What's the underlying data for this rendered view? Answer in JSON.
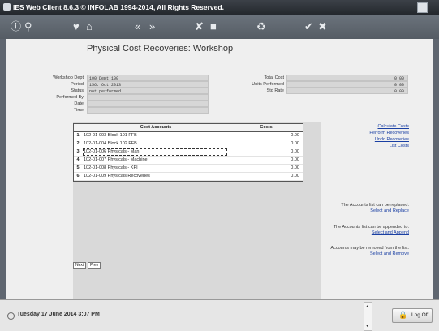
{
  "window": {
    "title": "IES Web Client 8.6.3 © INFOLAB 1994-2014, All Rights Reserved."
  },
  "page": {
    "heading": "Physical Cost Recoveries: Workshop"
  },
  "form": {
    "workshop_dept_label": "Workshop Dept",
    "workshop_dept_value": "100 Dept 100",
    "period_label": "Period",
    "period_value": "156: Oct 2013",
    "status_label": "Status",
    "status_value": "not performed",
    "performed_by_label": "Performed By",
    "performed_by_value": "",
    "date_label": "Date",
    "date_value": "",
    "time_label": "Time",
    "time_value": "",
    "total_cost_label": "Total Cost",
    "total_cost_value": "0.00",
    "units_performed_label": "Units Performed",
    "units_performed_value": "0.00",
    "std_rate_label": "Std Rate",
    "std_rate_value": "0.00"
  },
  "table": {
    "header_accounts": "Cost Accounts",
    "header_costs": "Costs",
    "rows": [
      {
        "num": "1",
        "account": "102-01-003 Block 101 FFB",
        "cost": "0.00"
      },
      {
        "num": "2",
        "account": "102-01-004 Block 102 FFB",
        "cost": "0.00"
      },
      {
        "num": "3",
        "account": "102-01-006 Physicals - Man",
        "cost": "0.00"
      },
      {
        "num": "4",
        "account": "102-01-007 Physicals - Machine",
        "cost": "0.00"
      },
      {
        "num": "5",
        "account": "102-01-008 Physicals - KPI",
        "cost": "0.00"
      },
      {
        "num": "6",
        "account": "102-01-009 Physicals Recoveries",
        "cost": "0.00"
      }
    ],
    "next_label": "Next",
    "prev_label": "Prev"
  },
  "actions": {
    "calculate_costs": "Calculate Costs",
    "perform_recoveries": "Perform Recoveries",
    "undo_recoveries": "Undo Recoveries",
    "list_costs": "List Costs"
  },
  "help": {
    "replace_note": "The Accounts list can be replaced.",
    "replace_link": "Select and Replace",
    "append_note": "The Accounts list can be appended to.",
    "append_link": "Select and Append",
    "remove_note": "Accounts may be removed from the list.",
    "remove_link": "Select and Remove"
  },
  "status": {
    "datetime": "Tuesday 17 June 2014 3:07 PM",
    "logoff_label": "Log Off"
  },
  "icons": {
    "info": "info-icon",
    "search": "search-icon",
    "heart": "heart-icon",
    "home": "home-icon",
    "back": "double-left-icon",
    "forward": "double-right-icon",
    "tools": "tools-icon",
    "stop": "stop-icon",
    "recycle": "recycle-icon",
    "ok": "check-icon",
    "cancel": "cancel-icon"
  }
}
